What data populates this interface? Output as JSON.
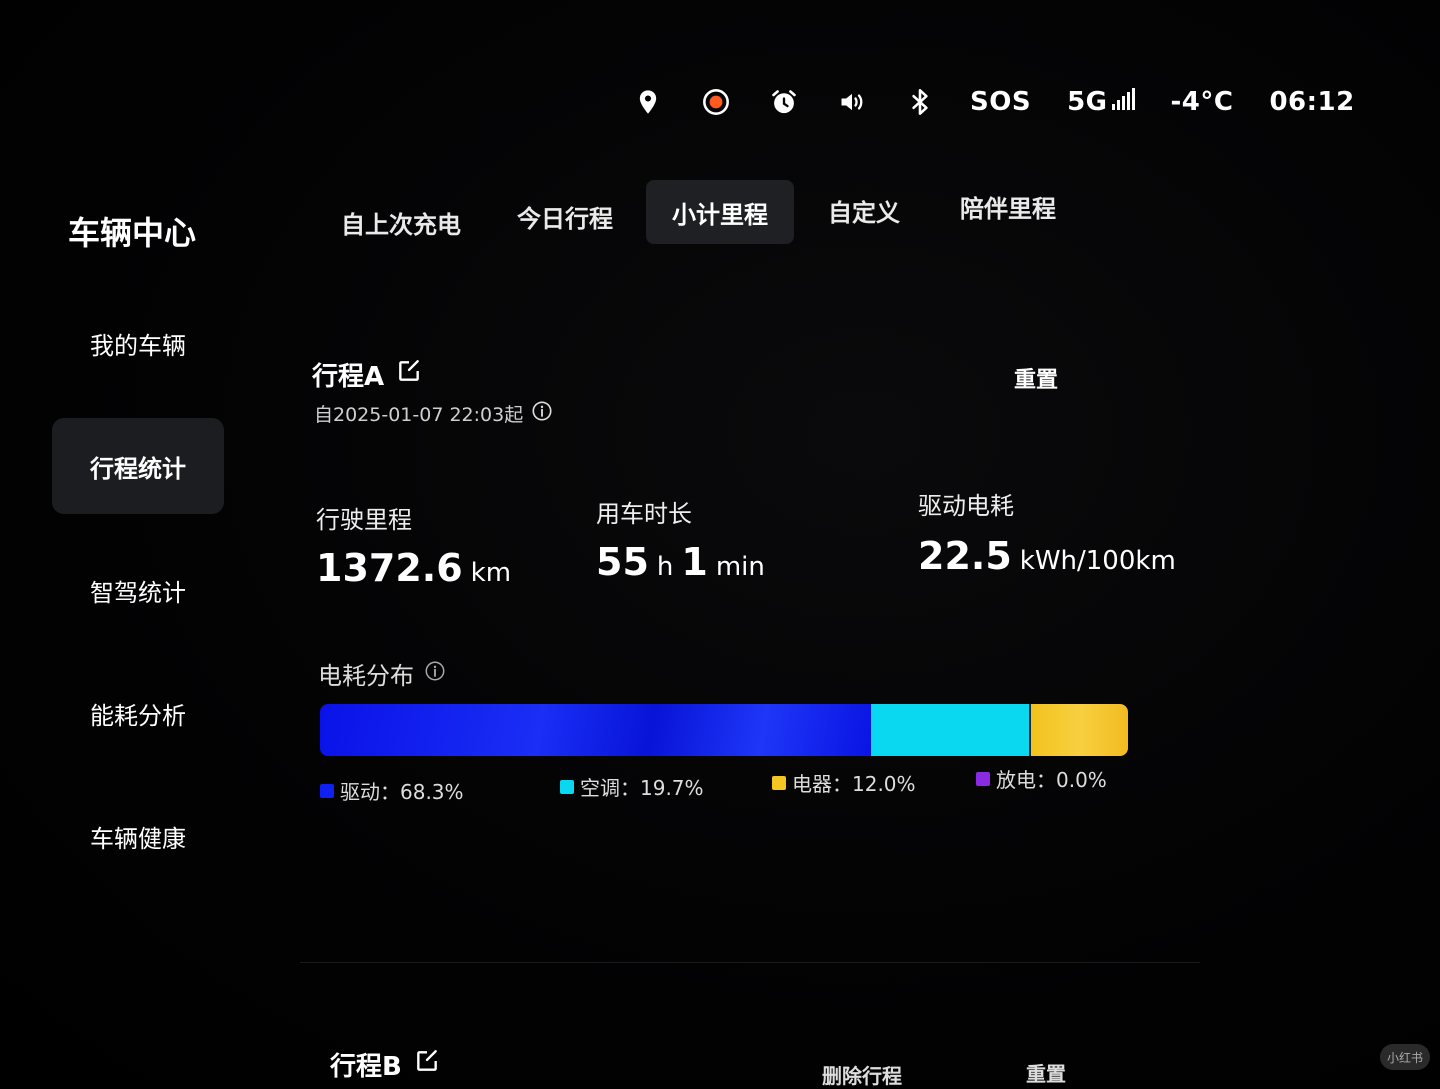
{
  "status_bar": {
    "icons": [
      "location-pin-icon",
      "record-icon",
      "alarm-clock-icon",
      "speaker-icon",
      "bluetooth-icon"
    ],
    "sos": "SOS",
    "network": "5G",
    "temperature": "-4°C",
    "time": "06:12",
    "record_color": "#ff5a1f"
  },
  "sidebar": {
    "title": "车辆中心",
    "items": [
      {
        "label": "我的车辆"
      },
      {
        "label": "行程统计"
      },
      {
        "label": "智驾统计"
      },
      {
        "label": "能耗分析"
      },
      {
        "label": "车辆健康"
      }
    ],
    "active_index": 1
  },
  "tabs": [
    {
      "label": "自上次充电"
    },
    {
      "label": "今日行程"
    },
    {
      "label": "小计里程"
    },
    {
      "label": "自定义"
    },
    {
      "label": "陪伴里程"
    }
  ],
  "active_tab": 2,
  "trip_a": {
    "title": "行程A",
    "since": "自2025-01-07 22:03起",
    "reset_label": "重置",
    "metrics": {
      "distance": {
        "label": "行驶里程",
        "value": "1372.6",
        "unit": "km"
      },
      "duration": {
        "label": "用车时长",
        "hours": "55",
        "hours_unit": "h",
        "minutes": "1",
        "minutes_unit": "min"
      },
      "consumption": {
        "label": "驱动电耗",
        "value": "22.5",
        "unit": "kWh/100km"
      }
    },
    "distribution": {
      "title": "电耗分布",
      "segments": [
        {
          "name": "驱动",
          "label": "驱动：68.3%",
          "percent": 68.3,
          "color": "#1020f0"
        },
        {
          "name": "空调",
          "label": "空调：19.7%",
          "percent": 19.7,
          "color": "#0ad8f0"
        },
        {
          "name": "电器",
          "label": "电器：12.0%",
          "percent": 12.0,
          "color": "#f5c524"
        },
        {
          "name": "放电",
          "label": "放电：0.0%",
          "percent": 0.0,
          "color": "#8a2be2"
        }
      ]
    }
  },
  "trip_b": {
    "title": "行程B",
    "delete_label": "删除行程",
    "reset_label": "重置"
  },
  "watermark": "小红书"
}
